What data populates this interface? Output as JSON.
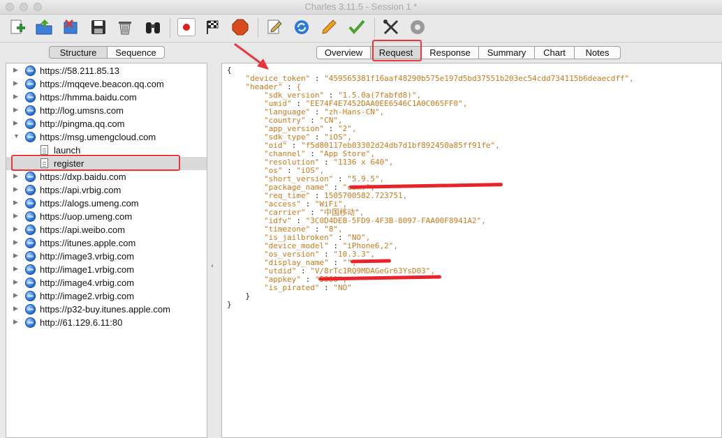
{
  "window": {
    "title": "Charles 3.11.5 - Session 1 *"
  },
  "toolbar": {
    "buttons": [
      {
        "name": "new-session-icon",
        "color": "#2e8b3a"
      },
      {
        "name": "open-session-icon",
        "color": "#2d6fd0"
      },
      {
        "name": "close-session-icon",
        "color": "#d13a2e"
      },
      {
        "name": "save-icon",
        "color": "#444444"
      },
      {
        "name": "trash-icon",
        "color": "#777777"
      },
      {
        "name": "find-binoculars-icon",
        "color": "#333333"
      },
      {
        "name": "record-icon",
        "color": "#e02020"
      },
      {
        "name": "throttle-flag-icon",
        "color": "#222222"
      },
      {
        "name": "breakpoints-stop-icon",
        "color": "#d94a1c"
      },
      {
        "name": "edit-pencil-icon",
        "color": "#777777"
      },
      {
        "name": "repeat-icon",
        "color": "#2a7bd8"
      },
      {
        "name": "edit-request-icon",
        "color": "#f08a00"
      },
      {
        "name": "validate-check-icon",
        "color": "#4aa02c"
      },
      {
        "name": "tools-icon",
        "color": "#333333"
      },
      {
        "name": "settings-gear-icon",
        "color": "#888888"
      }
    ]
  },
  "left": {
    "view_tabs": [
      "Structure",
      "Sequence"
    ],
    "tree": [
      {
        "label": "https://58.211.85.13"
      },
      {
        "label": "https://mqqeve.beacon.qq.com"
      },
      {
        "label": "https://hmma.baidu.com"
      },
      {
        "label": "http://log.umsns.com"
      },
      {
        "label": "http://pingma.qq.com"
      },
      {
        "label": "https://msg.umengcloud.com"
      },
      {
        "label": "launch"
      },
      {
        "label": "register"
      },
      {
        "label": "https://dxp.baidu.com"
      },
      {
        "label": "https://api.vrbig.com"
      },
      {
        "label": "https://alogs.umeng.com"
      },
      {
        "label": "https://uop.umeng.com"
      },
      {
        "label": "https://api.weibo.com"
      },
      {
        "label": "https://itunes.apple.com"
      },
      {
        "label": "http://image3.vrbig.com"
      },
      {
        "label": "http://image1.vrbig.com"
      },
      {
        "label": "http://image4.vrbig.com"
      },
      {
        "label": "http://image2.vrbig.com"
      },
      {
        "label": "https://p32-buy.itunes.apple.com"
      },
      {
        "label": "http://61.129.6.11:80"
      }
    ]
  },
  "right": {
    "tabs": [
      "Overview",
      "Request",
      "Response",
      "Summary",
      "Chart",
      "Notes"
    ],
    "selected_tab": "Request",
    "json_lines": [
      "{",
      "    \"device_token\" : \"459565381f16aaf48290b575e197d5bd37551b203ec54cdd734115b6deaecdff\",",
      "    \"header\" : {",
      "        \"sdk_version\" : \"1.5.0a(7fabfd8)\",",
      "        \"umid\" : \"EE74F4E7452DAA0EE6546C1A0C065FF0\",",
      "        \"language\" : \"zh-Hans-CN\",",
      "        \"country\" : \"CN\",",
      "        \"app_version\" : \"2\",",
      "        \"sdk_type\" : \"iOS\",",
      "        \"oid\" : \"f5d80117eb03302d24db7d1bf892450a85ff91fe\",",
      "        \"channel\" : \"App Store\",",
      "        \"resolution\" : \"1136 x 640\",",
      "        \"os\" : \"iOS\",",
      "        \"short_version\" : \"5.9.5\",",
      "        \"package_name\" : \"com.\",",
      "        \"req_time\" : 1505700582.723751,",
      "        \"access\" : \"WiFi\",",
      "        \"carrier\" : \"中国移动\",",
      "        \"idfv\" : \"3C0D4DEB-5FD9-4F3B-8097-FAA00F8941A2\",",
      "        \"timezone\" : \"8\",",
      "        \"is_jailbroken\" : \"NO\",",
      "        \"device_model\" : \"iPhone6,2\",",
      "        \"os_version\" : \"10.3.3\",",
      "        \"display_name\" : \"\",",
      "        \"utdid\" : \"V/8rTc1RQ9MDAGeGr63YsD03\",",
      "        \"appkey\" : \"5000\",",
      "        \"is_pirated\" : \"NO\"",
      "    }",
      "}"
    ]
  },
  "annotation": {
    "color": "#e8363c"
  }
}
